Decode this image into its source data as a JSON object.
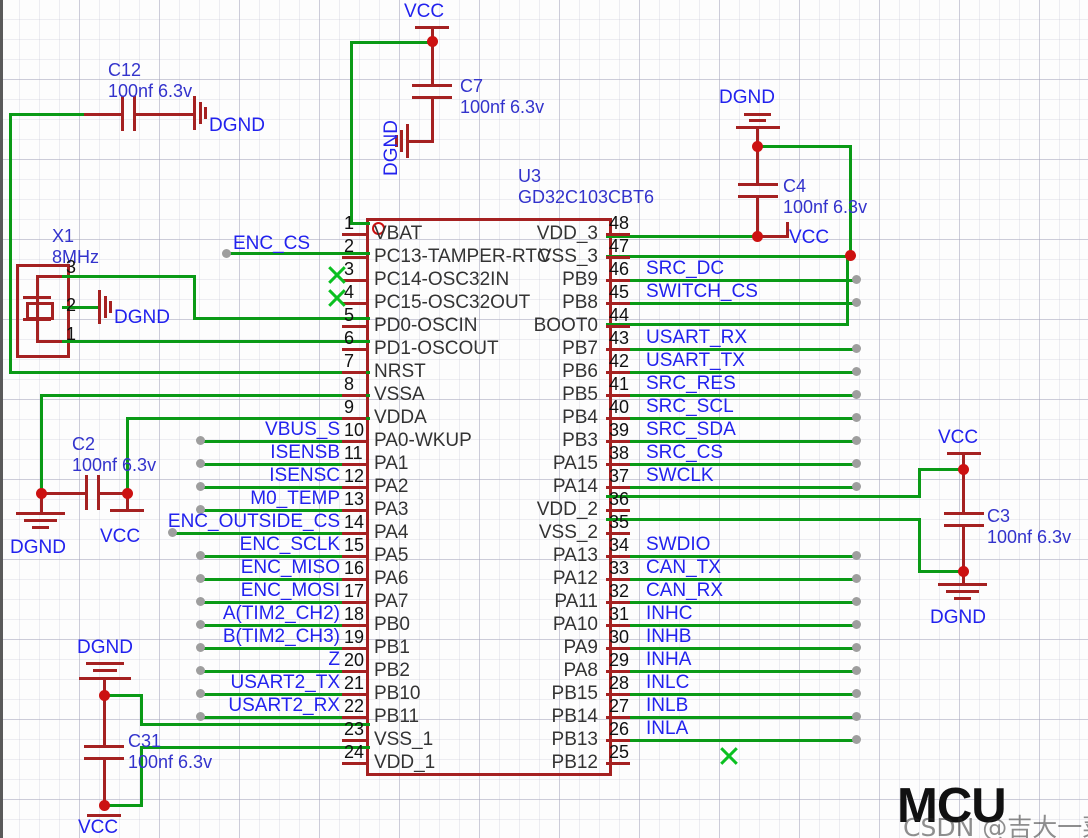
{
  "sheet": {
    "title": "MCU",
    "watermark": "CSDN @吉大一菜鸡"
  },
  "colors": {
    "wire": "#0a9a16",
    "symbol": "#a52121",
    "label": "#2222ee",
    "pin_text": "#333333",
    "junction": "#cc1111",
    "nc_mark": "#0ac020"
  },
  "ic": {
    "designator": "U3",
    "part": "GD32C103CBT6",
    "left_pins": [
      {
        "num": "1",
        "name": "VBAT"
      },
      {
        "num": "2",
        "name": "PC13-TAMPER-RTC"
      },
      {
        "num": "3",
        "name": "PC14-OSC32IN"
      },
      {
        "num": "4",
        "name": "PC15-OSC32OUT"
      },
      {
        "num": "5",
        "name": "PD0-OSCIN"
      },
      {
        "num": "6",
        "name": "PD1-OSCOUT"
      },
      {
        "num": "7",
        "name": "NRST"
      },
      {
        "num": "8",
        "name": "VSSA"
      },
      {
        "num": "9",
        "name": "VDDA"
      },
      {
        "num": "10",
        "name": "PA0-WKUP"
      },
      {
        "num": "11",
        "name": "PA1"
      },
      {
        "num": "12",
        "name": "PA2"
      },
      {
        "num": "13",
        "name": "PA3"
      },
      {
        "num": "14",
        "name": "PA4"
      },
      {
        "num": "15",
        "name": "PA5"
      },
      {
        "num": "16",
        "name": "PA6"
      },
      {
        "num": "17",
        "name": "PA7"
      },
      {
        "num": "18",
        "name": "PB0"
      },
      {
        "num": "19",
        "name": "PB1"
      },
      {
        "num": "20",
        "name": "PB2"
      },
      {
        "num": "21",
        "name": "PB10"
      },
      {
        "num": "22",
        "name": "PB11"
      },
      {
        "num": "23",
        "name": "VSS_1"
      },
      {
        "num": "24",
        "name": "VDD_1"
      }
    ],
    "right_pins": [
      {
        "num": "48",
        "name": "VDD_3"
      },
      {
        "num": "47",
        "name": "VSS_3"
      },
      {
        "num": "46",
        "name": "PB9"
      },
      {
        "num": "45",
        "name": "PB8"
      },
      {
        "num": "44",
        "name": "BOOT0"
      },
      {
        "num": "43",
        "name": "PB7"
      },
      {
        "num": "42",
        "name": "PB6"
      },
      {
        "num": "41",
        "name": "PB5"
      },
      {
        "num": "40",
        "name": "PB4"
      },
      {
        "num": "39",
        "name": "PB3"
      },
      {
        "num": "38",
        "name": "PA15"
      },
      {
        "num": "37",
        "name": "PA14"
      },
      {
        "num": "36",
        "name": "VDD_2"
      },
      {
        "num": "35",
        "name": "VSS_2"
      },
      {
        "num": "34",
        "name": "PA13"
      },
      {
        "num": "33",
        "name": "PA12"
      },
      {
        "num": "32",
        "name": "PA11"
      },
      {
        "num": "31",
        "name": "PA10"
      },
      {
        "num": "30",
        "name": "PA9"
      },
      {
        "num": "29",
        "name": "PA8"
      },
      {
        "num": "28",
        "name": "PB15"
      },
      {
        "num": "27",
        "name": "PB14"
      },
      {
        "num": "26",
        "name": "PB13"
      },
      {
        "num": "25",
        "name": "PB12"
      }
    ]
  },
  "net_labels_left": [
    {
      "text": "ENC_CS",
      "pin": "2"
    },
    {
      "text": "VBUS_S",
      "pin": "10"
    },
    {
      "text": "ISENSB",
      "pin": "11"
    },
    {
      "text": "ISENSC",
      "pin": "12"
    },
    {
      "text": "M0_TEMP",
      "pin": "13"
    },
    {
      "text": "ENC_OUTSIDE_CS",
      "pin": "14"
    },
    {
      "text": "ENC_SCLK",
      "pin": "15"
    },
    {
      "text": "ENC_MISO",
      "pin": "16"
    },
    {
      "text": "ENC_MOSI",
      "pin": "17"
    },
    {
      "text": "A(TIM2_CH2)",
      "pin": "18"
    },
    {
      "text": "B(TIM2_CH3)",
      "pin": "19"
    },
    {
      "text": "Z",
      "pin": "20"
    },
    {
      "text": "USART2_TX",
      "pin": "21"
    },
    {
      "text": "USART2_RX",
      "pin": "22"
    }
  ],
  "net_labels_right": [
    {
      "text": "SRC_DC",
      "pin": "46"
    },
    {
      "text": "SWITCH_CS",
      "pin": "45"
    },
    {
      "text": "USART_RX",
      "pin": "43"
    },
    {
      "text": "USART_TX",
      "pin": "42"
    },
    {
      "text": "SRC_RES",
      "pin": "41"
    },
    {
      "text": "SRC_SCL",
      "pin": "40"
    },
    {
      "text": "SRC_SDA",
      "pin": "39"
    },
    {
      "text": "SRC_CS",
      "pin": "38"
    },
    {
      "text": "SWCLK",
      "pin": "37"
    },
    {
      "text": "SWDIO",
      "pin": "34"
    },
    {
      "text": "CAN_TX",
      "pin": "33"
    },
    {
      "text": "CAN_RX",
      "pin": "32"
    },
    {
      "text": "INHC",
      "pin": "31"
    },
    {
      "text": "INHB",
      "pin": "30"
    },
    {
      "text": "INHA",
      "pin": "29"
    },
    {
      "text": "INLC",
      "pin": "28"
    },
    {
      "text": "INLB",
      "pin": "27"
    },
    {
      "text": "INLA",
      "pin": "26"
    }
  ],
  "capacitors": {
    "c12": {
      "ref": "C12",
      "value": "100nf 6.3v"
    },
    "c7": {
      "ref": "C7",
      "value": "100nf 6.3v"
    },
    "c4": {
      "ref": "C4",
      "value": "100nf 6.3v"
    },
    "c2": {
      "ref": "C2",
      "value": "100nf 6.3v"
    },
    "c3": {
      "ref": "C3",
      "value": "100nf 6.3v"
    },
    "c31": {
      "ref": "C31",
      "value": "100nf 6.3v"
    }
  },
  "crystal": {
    "ref": "X1",
    "value": "8MHz",
    "pins": [
      "3",
      "2",
      "1"
    ]
  },
  "power_labels": {
    "vcc_c7": "VCC",
    "dgnd_c7": "DGND",
    "dgnd_c12": "DGND",
    "dgnd_x1": "DGND",
    "dgnd_c4": "DGND",
    "vcc_c4": "VCC",
    "dgnd_c2": "DGND",
    "vcc_c2": "VCC",
    "vcc_c3": "VCC",
    "dgnd_c3": "DGND",
    "dgnd_c31": "DGND",
    "vcc_c31": "VCC"
  }
}
